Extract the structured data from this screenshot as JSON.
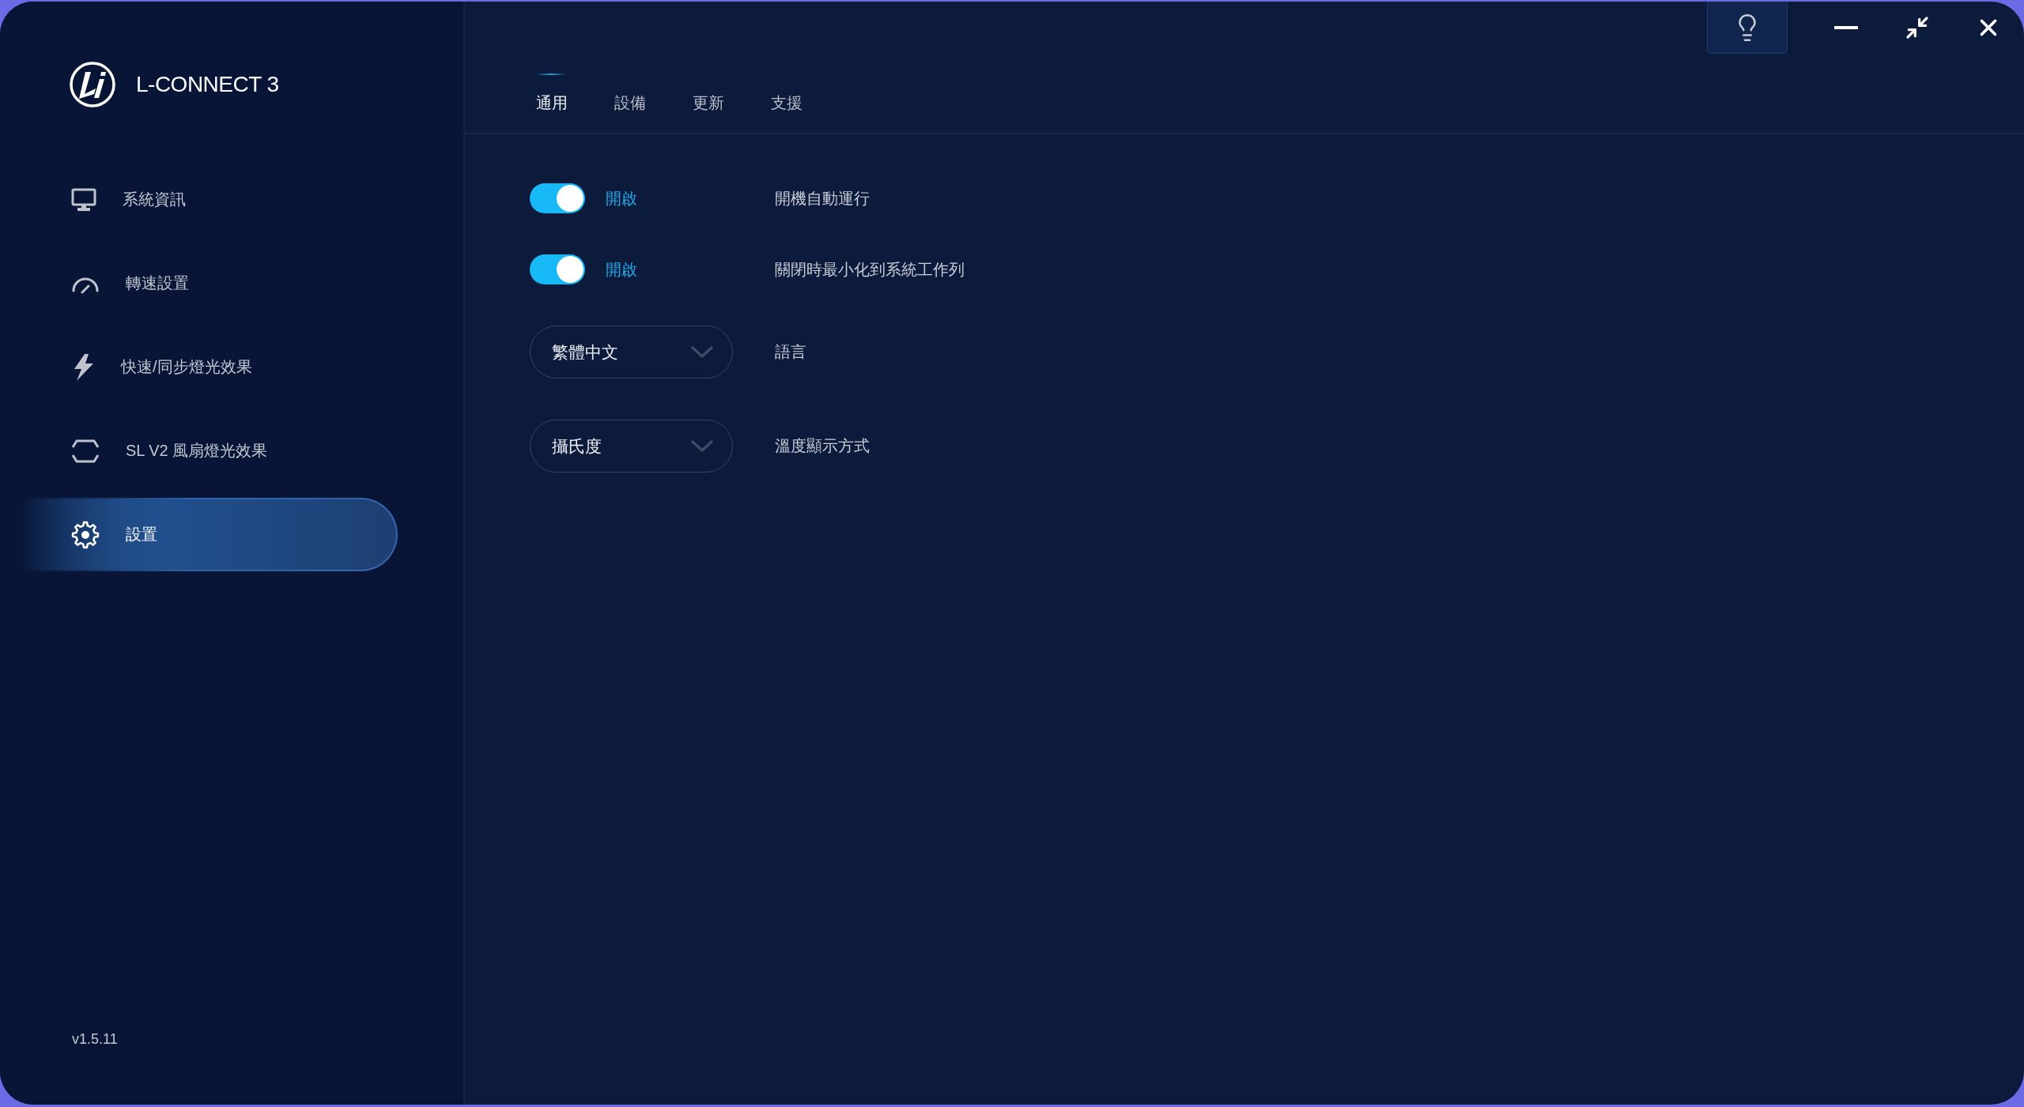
{
  "app": {
    "name": "L-CONNECT 3",
    "version": "v1.5.11"
  },
  "sidebar": {
    "items": [
      {
        "label": "系統資訊",
        "selected": false
      },
      {
        "label": "轉速設置",
        "selected": false
      },
      {
        "label": "快速/同步燈光效果",
        "selected": false
      },
      {
        "label": "SL V2 風扇燈光效果",
        "selected": false
      },
      {
        "label": "設置",
        "selected": true
      }
    ]
  },
  "tabs": [
    {
      "label": "通用",
      "selected": true
    },
    {
      "label": "設備",
      "selected": false
    },
    {
      "label": "更新",
      "selected": false
    },
    {
      "label": "支援",
      "selected": false
    }
  ],
  "settings": [
    {
      "kind": "toggle",
      "on": true,
      "state_label": "開啟",
      "label": "開機自動運行"
    },
    {
      "kind": "toggle",
      "on": true,
      "state_label": "開啟",
      "label": "關閉時最小化到系統工作列"
    },
    {
      "kind": "dropdown",
      "value": "繁體中文",
      "label": "語言"
    },
    {
      "kind": "dropdown",
      "value": "攝氏度",
      "label": "溫度顯示方式"
    }
  ]
}
